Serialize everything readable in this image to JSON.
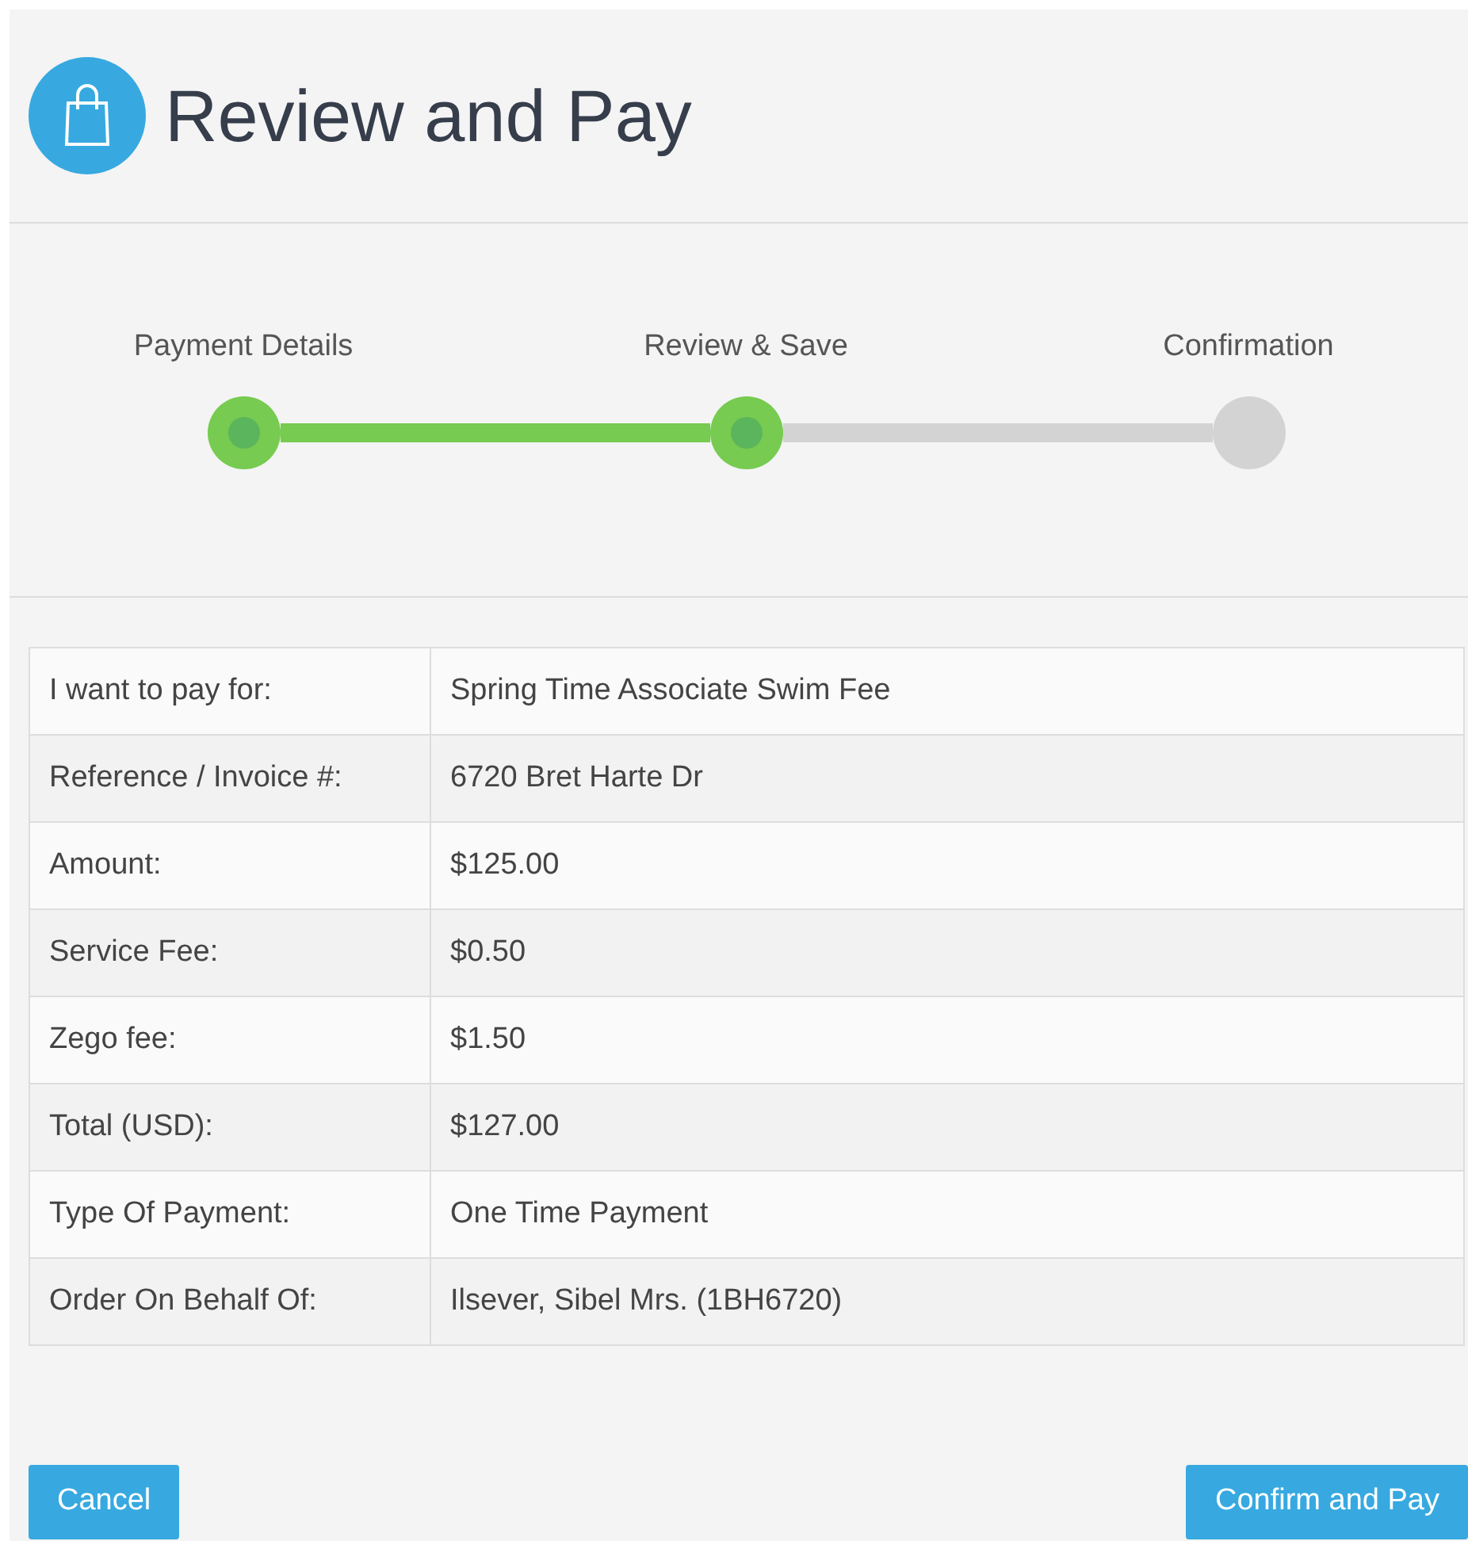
{
  "header": {
    "title": "Review and Pay"
  },
  "steps": [
    {
      "label": "Payment Details",
      "done": true
    },
    {
      "label": "Review & Save",
      "done": true
    },
    {
      "label": "Confirmation",
      "done": false
    }
  ],
  "details": [
    {
      "label": "I want to pay for:",
      "value": "Spring Time Associate Swim Fee"
    },
    {
      "label": "Reference / Invoice #:",
      "value": "6720 Bret Harte Dr"
    },
    {
      "label": "Amount:",
      "value": "$125.00"
    },
    {
      "label": "Service Fee:",
      "value": "$0.50"
    },
    {
      "label": "Zego fee:",
      "value": "$1.50"
    },
    {
      "label": "Total (USD):",
      "value": "$127.00"
    },
    {
      "label": "Type Of Payment:",
      "value": "One Time Payment"
    },
    {
      "label": "Order On Behalf Of:",
      "value": "Ilsever, Sibel Mrs. (1BH6720)"
    }
  ],
  "buttons": {
    "cancel": "Cancel",
    "confirm": "Confirm and Pay"
  }
}
